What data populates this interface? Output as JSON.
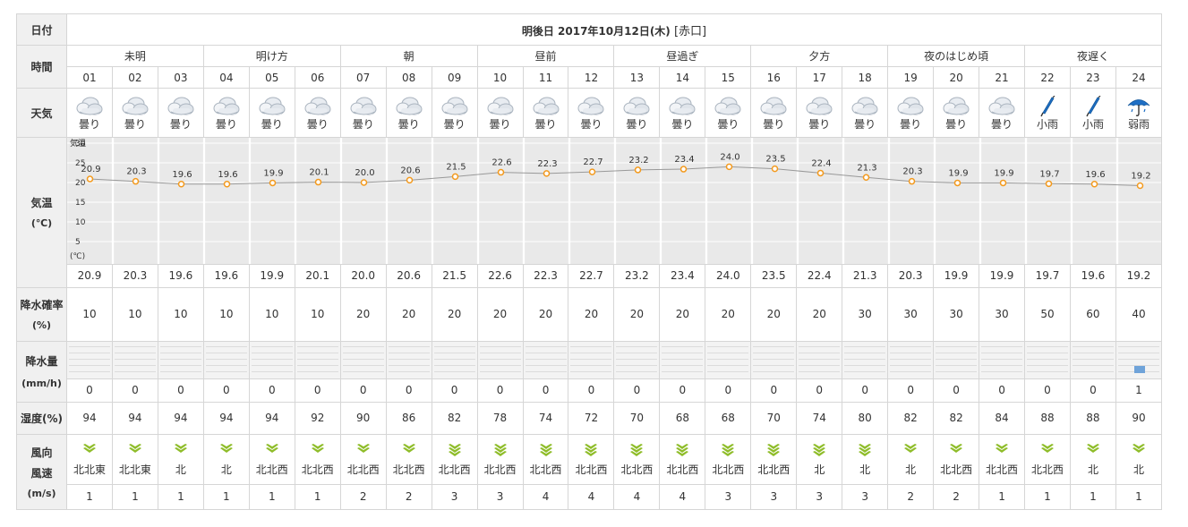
{
  "header": {
    "date_label": "日付",
    "title": "明後日 2017年10月12日(木)",
    "location": "[赤口]"
  },
  "labels": {
    "time": "時間",
    "weather": "天気",
    "temp": "気温",
    "temp_unit": "(℃)",
    "precip_prob": "降水確率",
    "precip_prob_unit": "(%)",
    "precip_amt": "降水量",
    "precip_amt_unit": "(mm/h)",
    "humidity": "湿度(%)",
    "wind_dir": "風向",
    "wind_speed": "風速",
    "wind_unit": "(m/s)"
  },
  "chart_legend": {
    "top": "気温",
    "bottom": "(℃)"
  },
  "periods": [
    {
      "name": "未明"
    },
    {
      "name": "明け方"
    },
    {
      "name": "朝"
    },
    {
      "name": "昼前"
    },
    {
      "name": "昼過ぎ"
    },
    {
      "name": "夕方"
    },
    {
      "name": "夜のはじめ頃"
    },
    {
      "name": "夜遅く"
    }
  ],
  "hours": [
    {
      "h": "01",
      "weather": "曇り",
      "icon": "cloud-icon",
      "temp": "20.9",
      "pop": "10",
      "rain": "0",
      "hum": "94",
      "dir": "北北東",
      "speed": "1",
      "wstr": 1
    },
    {
      "h": "02",
      "weather": "曇り",
      "icon": "cloud-icon",
      "temp": "20.3",
      "pop": "10",
      "rain": "0",
      "hum": "94",
      "dir": "北北東",
      "speed": "1",
      "wstr": 1
    },
    {
      "h": "03",
      "weather": "曇り",
      "icon": "cloud-icon",
      "temp": "19.6",
      "pop": "10",
      "rain": "0",
      "hum": "94",
      "dir": "北",
      "speed": "1",
      "wstr": 1
    },
    {
      "h": "04",
      "weather": "曇り",
      "icon": "cloud-icon",
      "temp": "19.6",
      "pop": "10",
      "rain": "0",
      "hum": "94",
      "dir": "北",
      "speed": "1",
      "wstr": 1
    },
    {
      "h": "05",
      "weather": "曇り",
      "icon": "cloud-icon",
      "temp": "19.9",
      "pop": "10",
      "rain": "0",
      "hum": "94",
      "dir": "北北西",
      "speed": "1",
      "wstr": 1
    },
    {
      "h": "06",
      "weather": "曇り",
      "icon": "cloud-icon",
      "temp": "20.1",
      "pop": "10",
      "rain": "0",
      "hum": "92",
      "dir": "北北西",
      "speed": "1",
      "wstr": 1
    },
    {
      "h": "07",
      "weather": "曇り",
      "icon": "cloud-icon",
      "temp": "20.0",
      "pop": "20",
      "rain": "0",
      "hum": "90",
      "dir": "北北西",
      "speed": "2",
      "wstr": 1
    },
    {
      "h": "08",
      "weather": "曇り",
      "icon": "cloud-icon",
      "temp": "20.6",
      "pop": "20",
      "rain": "0",
      "hum": "86",
      "dir": "北北西",
      "speed": "2",
      "wstr": 1
    },
    {
      "h": "09",
      "weather": "曇り",
      "icon": "cloud-icon",
      "temp": "21.5",
      "pop": "20",
      "rain": "0",
      "hum": "82",
      "dir": "北北西",
      "speed": "3",
      "wstr": 2
    },
    {
      "h": "10",
      "weather": "曇り",
      "icon": "cloud-icon",
      "temp": "22.6",
      "pop": "20",
      "rain": "0",
      "hum": "78",
      "dir": "北北西",
      "speed": "3",
      "wstr": 2
    },
    {
      "h": "11",
      "weather": "曇り",
      "icon": "cloud-icon",
      "temp": "22.3",
      "pop": "20",
      "rain": "0",
      "hum": "74",
      "dir": "北北西",
      "speed": "4",
      "wstr": 2
    },
    {
      "h": "12",
      "weather": "曇り",
      "icon": "cloud-icon",
      "temp": "22.7",
      "pop": "20",
      "rain": "0",
      "hum": "72",
      "dir": "北北西",
      "speed": "4",
      "wstr": 2
    },
    {
      "h": "13",
      "weather": "曇り",
      "icon": "cloud-icon",
      "temp": "23.2",
      "pop": "20",
      "rain": "0",
      "hum": "70",
      "dir": "北北西",
      "speed": "4",
      "wstr": 2
    },
    {
      "h": "14",
      "weather": "曇り",
      "icon": "cloud-icon",
      "temp": "23.4",
      "pop": "20",
      "rain": "0",
      "hum": "68",
      "dir": "北北西",
      "speed": "4",
      "wstr": 2
    },
    {
      "h": "15",
      "weather": "曇り",
      "icon": "cloud-icon",
      "temp": "24.0",
      "pop": "20",
      "rain": "0",
      "hum": "68",
      "dir": "北北西",
      "speed": "3",
      "wstr": 2
    },
    {
      "h": "16",
      "weather": "曇り",
      "icon": "cloud-icon",
      "temp": "23.5",
      "pop": "20",
      "rain": "0",
      "hum": "70",
      "dir": "北北西",
      "speed": "3",
      "wstr": 2
    },
    {
      "h": "17",
      "weather": "曇り",
      "icon": "cloud-icon",
      "temp": "22.4",
      "pop": "20",
      "rain": "0",
      "hum": "74",
      "dir": "北",
      "speed": "3",
      "wstr": 2
    },
    {
      "h": "18",
      "weather": "曇り",
      "icon": "cloud-icon",
      "temp": "21.3",
      "pop": "30",
      "rain": "0",
      "hum": "80",
      "dir": "北",
      "speed": "3",
      "wstr": 2
    },
    {
      "h": "19",
      "weather": "曇り",
      "icon": "cloud-icon",
      "temp": "20.3",
      "pop": "30",
      "rain": "0",
      "hum": "82",
      "dir": "北",
      "speed": "2",
      "wstr": 1
    },
    {
      "h": "20",
      "weather": "曇り",
      "icon": "cloud-icon",
      "temp": "19.9",
      "pop": "30",
      "rain": "0",
      "hum": "82",
      "dir": "北北西",
      "speed": "2",
      "wstr": 1
    },
    {
      "h": "21",
      "weather": "曇り",
      "icon": "cloud-icon",
      "temp": "19.9",
      "pop": "30",
      "rain": "0",
      "hum": "84",
      "dir": "北北西",
      "speed": "1",
      "wstr": 1
    },
    {
      "h": "22",
      "weather": "小雨",
      "icon": "closed-umbrella-icon",
      "temp": "19.7",
      "pop": "50",
      "rain": "0",
      "hum": "88",
      "dir": "北北西",
      "speed": "1",
      "wstr": 1
    },
    {
      "h": "23",
      "weather": "小雨",
      "icon": "closed-umbrella-icon",
      "temp": "19.6",
      "pop": "60",
      "rain": "0",
      "hum": "88",
      "dir": "北",
      "speed": "1",
      "wstr": 1
    },
    {
      "h": "24",
      "weather": "弱雨",
      "icon": "open-umbrella-icon",
      "temp": "19.2",
      "pop": "40",
      "rain": "1",
      "hum": "90",
      "dir": "北",
      "speed": "1",
      "wstr": 1
    }
  ],
  "chart_data": {
    "type": "line",
    "title": "",
    "x": [
      "01",
      "02",
      "03",
      "04",
      "05",
      "06",
      "07",
      "08",
      "09",
      "10",
      "11",
      "12",
      "13",
      "14",
      "15",
      "16",
      "17",
      "18",
      "19",
      "20",
      "21",
      "22",
      "23",
      "24"
    ],
    "y": [
      20.9,
      20.3,
      19.6,
      19.6,
      19.9,
      20.1,
      20.0,
      20.6,
      21.5,
      22.6,
      22.3,
      22.7,
      23.2,
      23.4,
      24.0,
      23.5,
      22.4,
      21.3,
      20.3,
      19.9,
      19.9,
      19.7,
      19.6,
      19.2
    ],
    "ylabel": "気温",
    "yticks": [
      5,
      10,
      15,
      20,
      25,
      30
    ],
    "ylim": [
      0,
      30
    ],
    "grid": true,
    "precip_mm": [
      0,
      0,
      0,
      0,
      0,
      0,
      0,
      0,
      0,
      0,
      0,
      0,
      0,
      0,
      0,
      0,
      0,
      0,
      0,
      0,
      0,
      0,
      0,
      1
    ]
  },
  "colors": {
    "line": "#999999",
    "marker_edge": "#f39a1e",
    "cloud": "#cfd6df",
    "umbrella": "#1e6fc5",
    "wind": "#8fbd2a",
    "rain_bar": "#6fa3d9"
  }
}
